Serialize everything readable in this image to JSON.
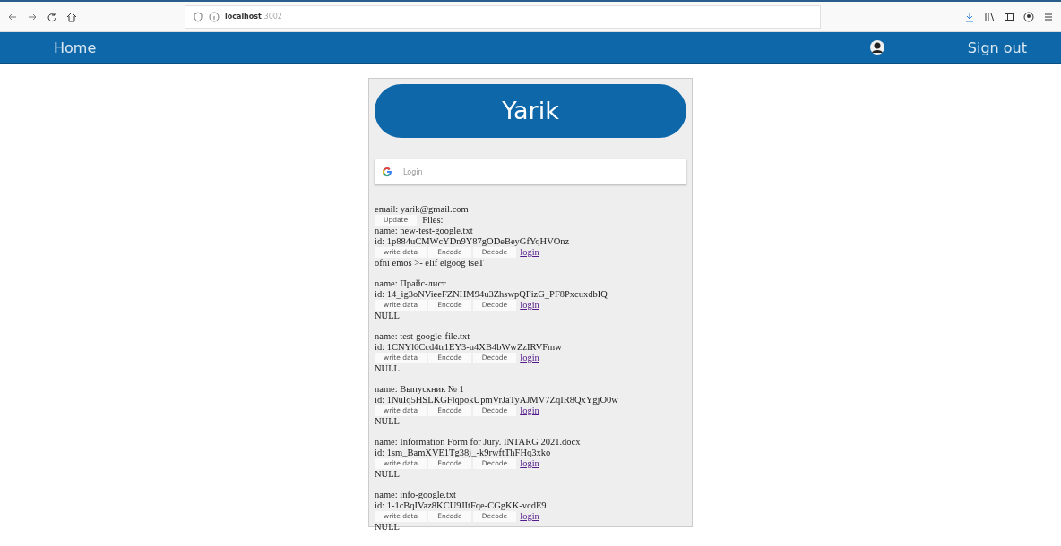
{
  "browser": {
    "address": "**localhost**:3002"
  },
  "navbar": {
    "home": "Home",
    "sign_out": "Sign out"
  },
  "profile": {
    "name": "Yarik",
    "login_button": "Login",
    "email": "email: yarik@gmail.com",
    "update_button": "Update",
    "files_label": "Files:"
  },
  "files": [
    {
      "name": "name: new-test-google.txt",
      "id": "id: 1p884uCMWcYDn9Y87gODeBeyGfYqHVOnz",
      "buttons": [
        "write data",
        "Encode",
        "Decode"
      ],
      "link": "login",
      "result": "ofni emos >- elif elgoog tseT"
    },
    {
      "name": "name: Прайс-лист",
      "id": "id: 14_ig3oNVieeFZNHM94u3ZhswpQFizG_PF8PxcuxdbIQ",
      "buttons": [
        "write data",
        "Encode",
        "Decode"
      ],
      "link": "login",
      "result": "NULL"
    },
    {
      "name": "name: test-google-file.txt",
      "id": "id: 1CNYl6Ccd4tr1EY3-u4XB4bWwZzIRVFmw",
      "buttons": [
        "write data",
        "Encode",
        "Decode"
      ],
      "link": "login",
      "result": "NULL"
    },
    {
      "name": "name: Выпускник № 1",
      "id": "id: 1NuIq5HSLKGFlqpokUpmVrJaTyAJMV7ZqIR8QxYgjO0w",
      "buttons": [
        "write data",
        "Encode",
        "Decode"
      ],
      "link": "login",
      "result": "NULL"
    },
    {
      "name": "name: Information Form for Jury. INTARG 2021.docx",
      "id": "id: 1sm_BamXVE1Tg38j_-k9rwftThFHq3xko",
      "buttons": [
        "write data",
        "Encode",
        "Decode"
      ],
      "link": "login",
      "result": "NULL"
    },
    {
      "name": "name: info-google.txt",
      "id": "id: 1-1cBqIVaz8KCU9JItFqe-CGgKK-vcdE9",
      "buttons": [
        "write data",
        "Encode",
        "Decode"
      ],
      "link": "login",
      "result": "NULL"
    }
  ]
}
